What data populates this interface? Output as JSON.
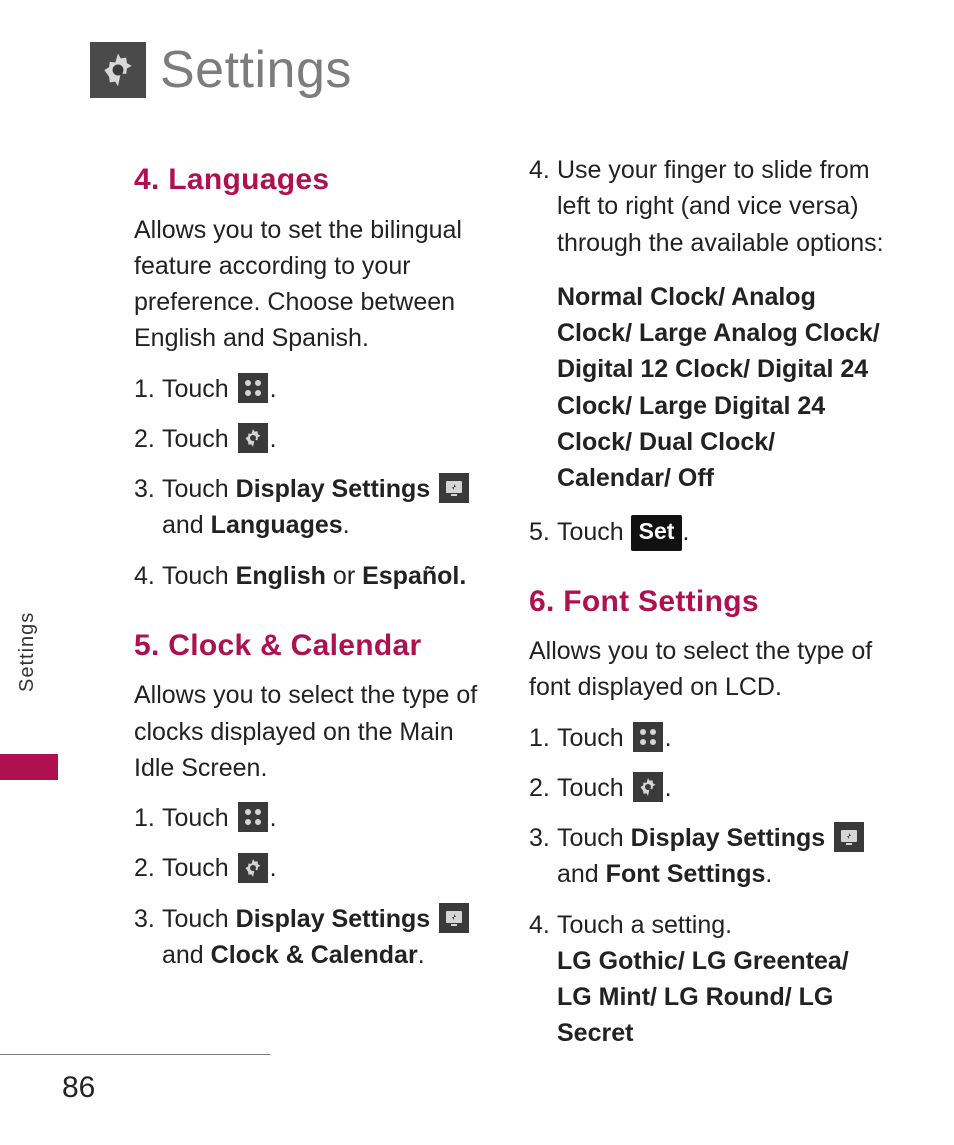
{
  "header": {
    "title": "Settings"
  },
  "sideTab": {
    "label": "Settings"
  },
  "pageNumber": "86",
  "left": {
    "sec4": {
      "heading": "4. Languages",
      "desc": "Allows you to set the bilingual feature according to your preference. Choose between English and Spanish.",
      "step1_n": "1.",
      "step1_a": "Touch ",
      "step1_b": ".",
      "step2_n": "2.",
      "step2_a": "Touch ",
      "step2_b": ".",
      "step3_n": "3.",
      "step3_a": "Touch ",
      "step3_ds": "Display Settings",
      "step3_b": " ",
      "step3_c": "and ",
      "step3_lang": "Languages",
      "step3_d": ".",
      "step4_n": "4.",
      "step4_a": "Touch ",
      "step4_en": "English",
      "step4_or": " or ",
      "step4_es": "Español."
    },
    "sec5": {
      "heading": "5. Clock & Calendar",
      "desc": "Allows you to select the type of clocks displayed on the Main Idle Screen.",
      "step1_n": "1.",
      "step1_a": "Touch ",
      "step1_b": ".",
      "step2_n": "2.",
      "step2_a": "Touch ",
      "step2_b": ".",
      "step3_n": "3.",
      "step3_a": "Touch ",
      "step3_ds": "Display Settings",
      "step3_b": " ",
      "step3_c": "and ",
      "step3_cc": "Clock & Calendar",
      "step3_d": "."
    }
  },
  "right": {
    "sec5cont": {
      "step4_n": "4.",
      "step4_a": "Use your finger to slide from left to right (and vice versa) through the available options:",
      "options": "Normal Clock/ Analog Clock/ Large Analog Clock/ Digital 12 Clock/ Digital 24 Clock/ Large Digital 24 Clock/ Dual Clock/ Calendar/ Off",
      "step5_n": "5.",
      "step5_a": "Touch ",
      "step5_set": "Set",
      "step5_b": "."
    },
    "sec6": {
      "heading": "6. Font Settings",
      "desc": "Allows you to select the type of font displayed on LCD.",
      "step1_n": "1.",
      "step1_a": "Touch ",
      "step1_b": ".",
      "step2_n": "2.",
      "step2_a": "Touch ",
      "step2_b": ".",
      "step3_n": "3.",
      "step3_a": "Touch ",
      "step3_ds": "Display Settings",
      "step3_b": " ",
      "step3_c": "and ",
      "step3_fs": "Font Settings",
      "step3_d": ".",
      "step4_n": "4.",
      "step4_a": "Touch a setting.",
      "step4_opts": "LG Gothic/ LG Greentea/ LG Mint/ LG Round/ LG Secret"
    }
  }
}
